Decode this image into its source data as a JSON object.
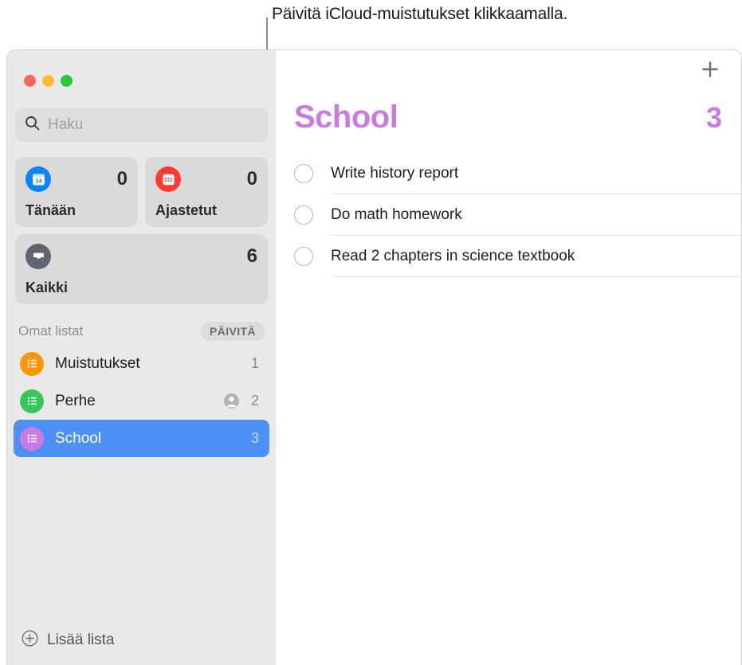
{
  "callout": {
    "text": "Päivitä iCloud-muistutukset klikkaamalla."
  },
  "window": {
    "traffic_lights": {
      "close": "close-button",
      "minimize": "minimize-button",
      "maximize": "maximize-button"
    }
  },
  "sidebar": {
    "search": {
      "placeholder": "Haku",
      "value": "",
      "icon": "search-icon"
    },
    "smart_lists": [
      {
        "label": "Tänään",
        "count": "0",
        "icon": "calendar-today-icon",
        "icon_color": "#0a84ff",
        "glyph": "14"
      },
      {
        "label": "Ajastetut",
        "count": "0",
        "icon": "calendar-scheduled-icon",
        "icon_color": "#ff3b30",
        "glyph": ""
      },
      {
        "label": "Kaikki",
        "count": "6",
        "icon": "inbox-tray-icon",
        "icon_color": "#5d6670",
        "glyph": ""
      }
    ],
    "lists_header": {
      "title": "Omat listat",
      "refresh_label": "PÄIVITÄ"
    },
    "lists": [
      {
        "name": "Muistutukset",
        "count": "1",
        "icon": "list-bullet-icon",
        "icon_color": "#ff9500",
        "shared": false,
        "selected": false
      },
      {
        "name": "Perhe",
        "count": "2",
        "icon": "list-bullet-icon",
        "icon_color": "#34c759",
        "shared": true,
        "shared_icon": "person-circle-icon",
        "selected": false
      },
      {
        "name": "School",
        "count": "3",
        "icon": "list-bullet-icon",
        "icon_color": "#cb7be0",
        "shared": false,
        "selected": true
      }
    ],
    "add_list": {
      "label": "Lisää lista",
      "icon": "plus-circle-icon"
    }
  },
  "main": {
    "add_reminder_icon": "plus-icon",
    "title": "School",
    "title_count": "3",
    "accent_color": "#cb7be0",
    "reminders": [
      {
        "text": "Write history report",
        "completed": false
      },
      {
        "text": "Do math homework",
        "completed": false
      },
      {
        "text": "Read 2 chapters in science textbook",
        "completed": false
      }
    ]
  }
}
